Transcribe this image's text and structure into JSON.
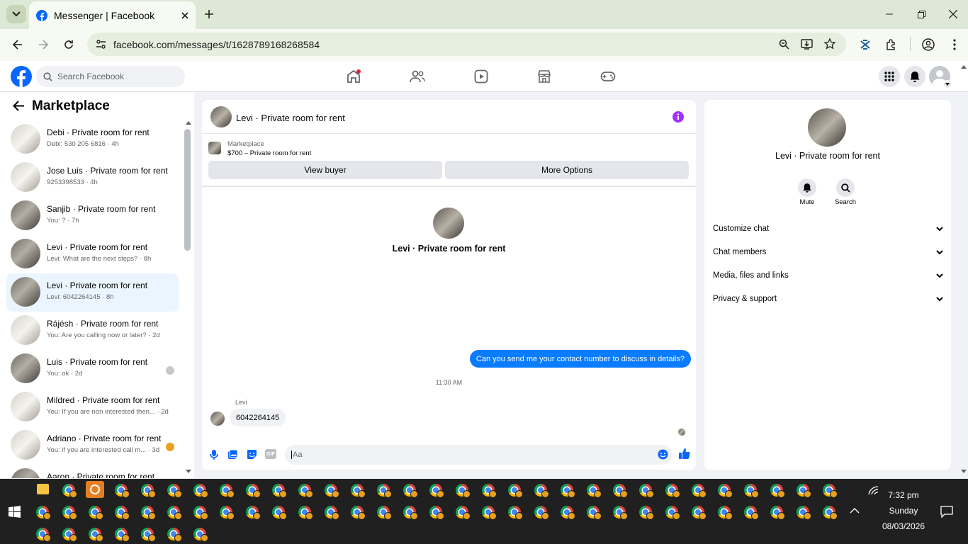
{
  "browser": {
    "tab_title": "Messenger | Facebook",
    "url": "facebook.com/messages/t/1628789168268584"
  },
  "facebook": {
    "search_placeholder": "Search Facebook"
  },
  "marketplace": {
    "title": "Marketplace",
    "conversations": [
      {
        "name": "Debi · Private room for rent",
        "preview": "Debi: 530 205 6816 · 4h"
      },
      {
        "name": "Jose Luis · Private room for rent",
        "preview": "9253398533 · 4h"
      },
      {
        "name": "Sanjib · Private room for rent",
        "preview": "You: ? · 7h"
      },
      {
        "name": "Levi · Private room for rent",
        "preview": "Levi: What are the next steps? · 8h"
      },
      {
        "name": "Levi · Private room for rent",
        "preview": "Levi: 6042264145 · 8h"
      },
      {
        "name": "Rájésh · Private room for rent",
        "preview": "You: Are you calling now or later? · 2d"
      },
      {
        "name": "Luis · Private room for rent",
        "preview": "You: ok · 2d"
      },
      {
        "name": "Mildred · Private room for rent",
        "preview": "You: If you are non interested then... · 2d"
      },
      {
        "name": "Adriano · Private room for rent",
        "preview": "You: if you are interested call m... · 3d"
      },
      {
        "name": "Aaron · Private room for rent",
        "preview": ""
      }
    ]
  },
  "chat": {
    "header_name": "Levi · Private room for rent",
    "listing_source": "Marketplace",
    "listing_title": "$700 – Private room for rent",
    "view_buyer": "View buyer",
    "more_options": "More Options",
    "profile_name": "Levi · Private room for rent",
    "outgoing_message": "Can you send me your contact number to discuss in details?",
    "timestamp": "11:30 AM",
    "sender_label": "Levi",
    "incoming_message": "6042264145",
    "composer_placeholder": "Aa"
  },
  "details": {
    "name": "Levi · Private room for rent",
    "mute_label": "Mute",
    "search_label": "Search",
    "sections": [
      "Customize chat",
      "Chat members",
      "Media, files and links",
      "Privacy & support"
    ]
  },
  "taskbar": {
    "time": "7:32 pm",
    "day": "Sunday",
    "date": "08/03/2026"
  },
  "colors": {
    "messenger_blue": "#0a7cff",
    "facebook_blue": "#0866ff",
    "selected_row": "#ebf5ff",
    "info_purple": "#a033ff"
  }
}
